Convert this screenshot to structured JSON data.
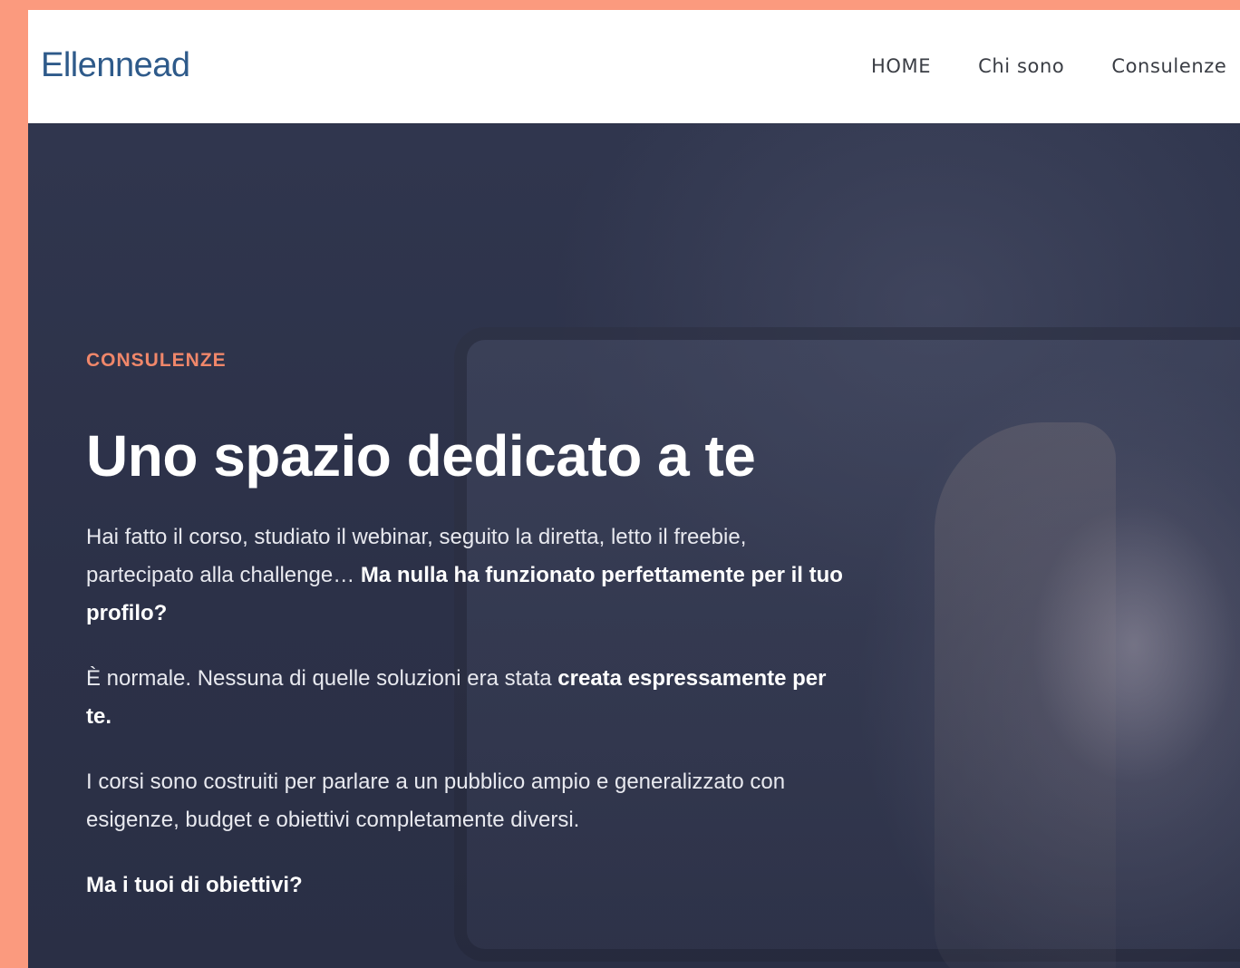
{
  "brand": {
    "logo_text": "Ellennead"
  },
  "nav": {
    "items": [
      {
        "label": "HOME"
      },
      {
        "label": "Chi sono"
      },
      {
        "label": "Consulenze"
      }
    ]
  },
  "hero": {
    "eyebrow": "CONSULENZE",
    "title": "Uno spazio dedicato a te",
    "p1": {
      "text": "Hai fatto il corso, studiato il webinar, seguito la diretta, letto il freebie, partecipato alla challenge… ",
      "bold": "Ma nulla ha funzionato perfettamente per il tuo profilo?"
    },
    "p2": {
      "text": "È normale. Nessuna di quelle soluzioni era stata ",
      "bold": "creata espressamente per te."
    },
    "p3": {
      "text": "I corsi sono costruiti per parlare a un pubblico ampio e generalizzato con esigenze, budget e obiettivi completamente diversi."
    },
    "p4": {
      "bold": "Ma i tuoi di obiettivi?"
    }
  },
  "colors": {
    "page_border": "#fb9a7e",
    "accent": "#f0876a",
    "logo": "#2e5a8a",
    "hero_bg": "#2d3249"
  }
}
